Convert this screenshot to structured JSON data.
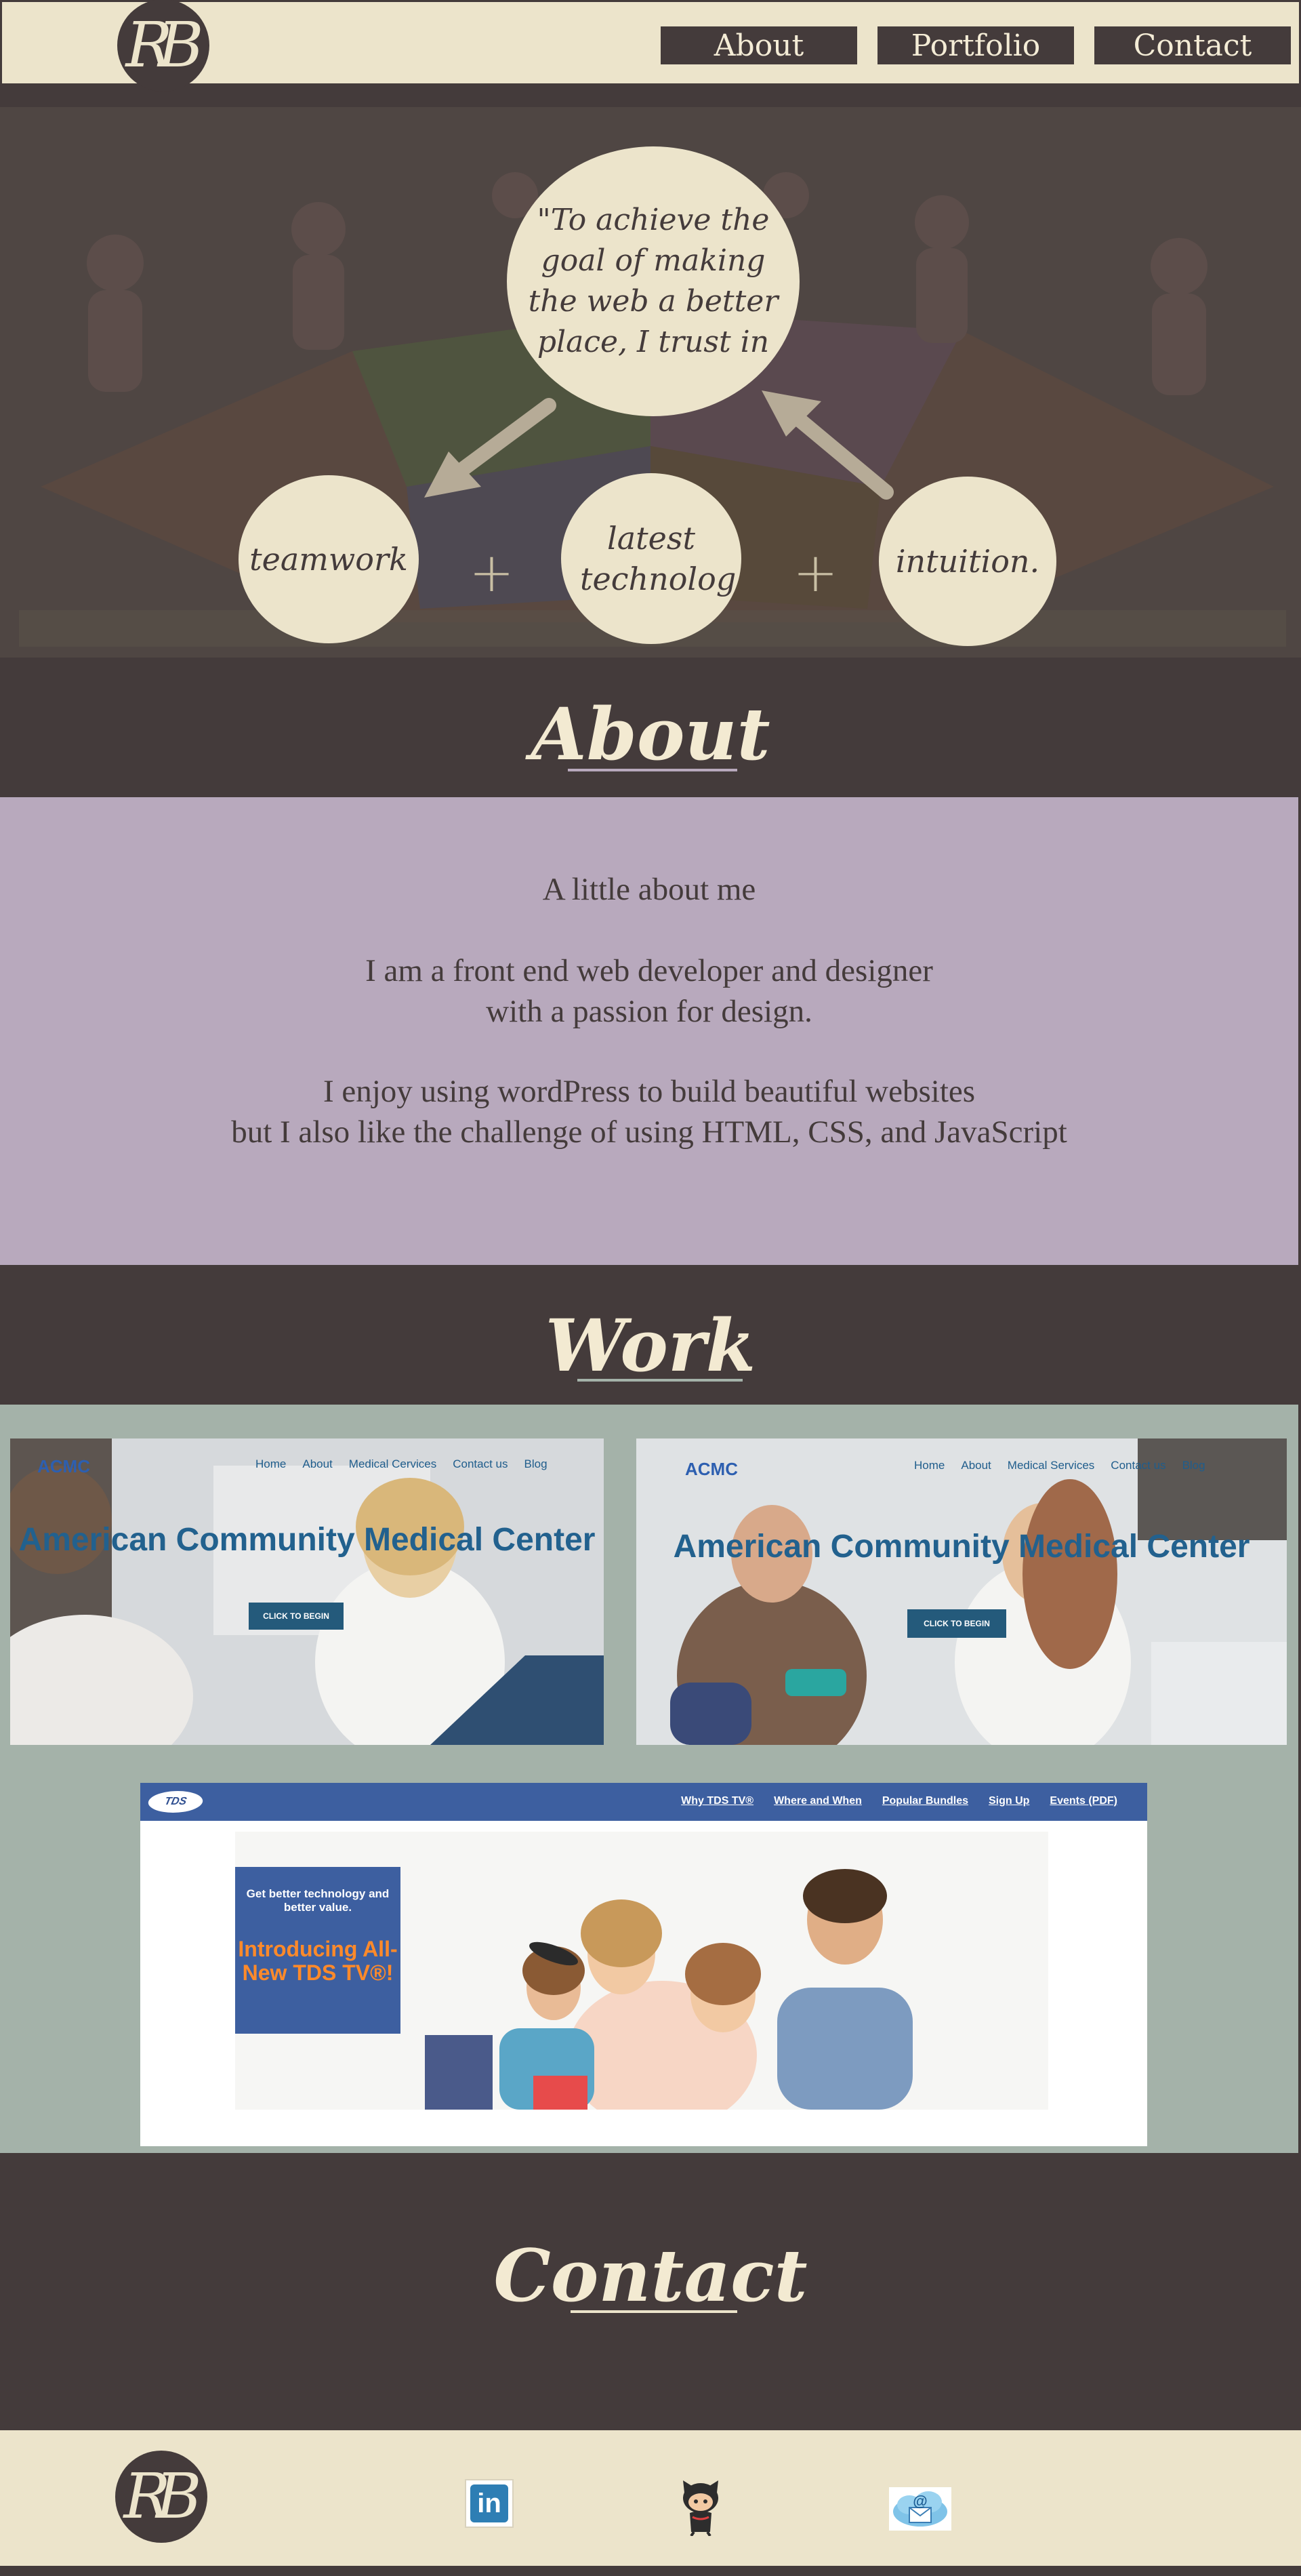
{
  "header": {
    "logo_text": "RB",
    "nav": [
      {
        "label": "About"
      },
      {
        "label": "Portfolio"
      },
      {
        "label": "Contact"
      }
    ]
  },
  "hero": {
    "quote": "\"To achieve the goal of making the web a better place, I trust in",
    "bubbles": [
      "teamwork",
      "latest technolog",
      "intuition."
    ],
    "plus": "+"
  },
  "about": {
    "title": "About",
    "heading": "A little about me",
    "line1": "I am a front end web developer and designer",
    "line2": "with a passion for design.",
    "line3": "I enjoy using wordPress to build beautiful websites",
    "line4": "but I also like the challenge of using HTML, CSS, and JavaScript"
  },
  "work": {
    "title": "Work",
    "acmc1": {
      "logo": "ACMC",
      "nav": [
        "Home",
        "About",
        "Medical Cervices",
        "Contact us",
        "Blog"
      ],
      "title": "American Community Medical Center",
      "cta": "CLICK TO BEGIN"
    },
    "acmc2": {
      "logo": "ACMC",
      "nav": [
        "Home",
        "About",
        "Medical Services",
        "Contact us",
        "Blog"
      ],
      "title": "American Community Medical Center",
      "cta": "CLICK TO BEGIN"
    },
    "tds": {
      "logo": "TDS",
      "nav": [
        "Why TDS TV®",
        "Where and When",
        "Popular Bundles",
        "Sign Up",
        "Events (PDF)"
      ],
      "promo_small": "Get better technology and better value.",
      "promo_big": "Introducing All-New TDS TV®!"
    }
  },
  "contact": {
    "title": "Contact",
    "logo_text": "RB",
    "social": [
      {
        "name": "linkedin-icon",
        "label": "in"
      },
      {
        "name": "github-icon",
        "label": ""
      },
      {
        "name": "email-icon",
        "label": "@"
      }
    ]
  },
  "colors": {
    "dark": "#443b3b",
    "cream": "#ece4cb",
    "lavender": "#b8a9bd",
    "sage": "#a4b2a9"
  }
}
